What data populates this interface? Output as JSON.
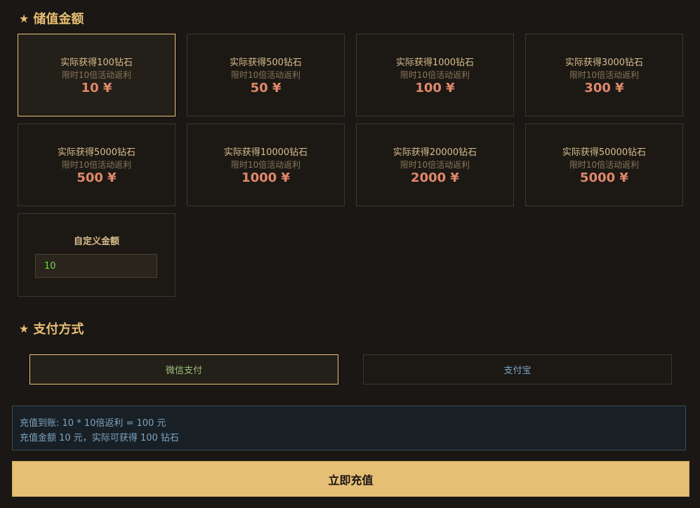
{
  "sections": {
    "amount_title": "储值金额",
    "pay_title": "支付方式",
    "star": "★"
  },
  "packages": [
    {
      "line1": "实际获得100钻石",
      "line2": "限时10倍活动返利",
      "price": "10 ¥",
      "selected": true
    },
    {
      "line1": "实际获得500钻石",
      "line2": "限时10倍活动返利",
      "price": "50 ¥",
      "selected": false
    },
    {
      "line1": "实际获得1000钻石",
      "line2": "限时10倍活动返利",
      "price": "100 ¥",
      "selected": false
    },
    {
      "line1": "实际获得3000钻石",
      "line2": "限时10倍活动返利",
      "price": "300 ¥",
      "selected": false
    },
    {
      "line1": "实际获得5000钻石",
      "line2": "限时10倍活动返利",
      "price": "500 ¥",
      "selected": false
    },
    {
      "line1": "实际获得10000钻石",
      "line2": "限时10倍活动返利",
      "price": "1000 ¥",
      "selected": false
    },
    {
      "line1": "实际获得20000钻石",
      "line2": "限时10倍活动返利",
      "price": "2000 ¥",
      "selected": false
    },
    {
      "line1": "实际获得50000钻石",
      "line2": "限时10倍活动返利",
      "price": "5000 ¥",
      "selected": false
    }
  ],
  "custom": {
    "label": "自定义金额",
    "value": "10"
  },
  "payment": {
    "wechat": "微信支付",
    "alipay": "支付宝",
    "selected": "wechat"
  },
  "info": {
    "line1": "充值到账: 10 * 10倍返利 = 100 元",
    "line2": "充值金额 10 元，实际可获得 100 钻石"
  },
  "submit_label": "立即充值",
  "colors": {
    "background": "#1a1714",
    "accent": "#e6bf76",
    "price": "#e0886a",
    "input_text": "#6ddc3f"
  }
}
